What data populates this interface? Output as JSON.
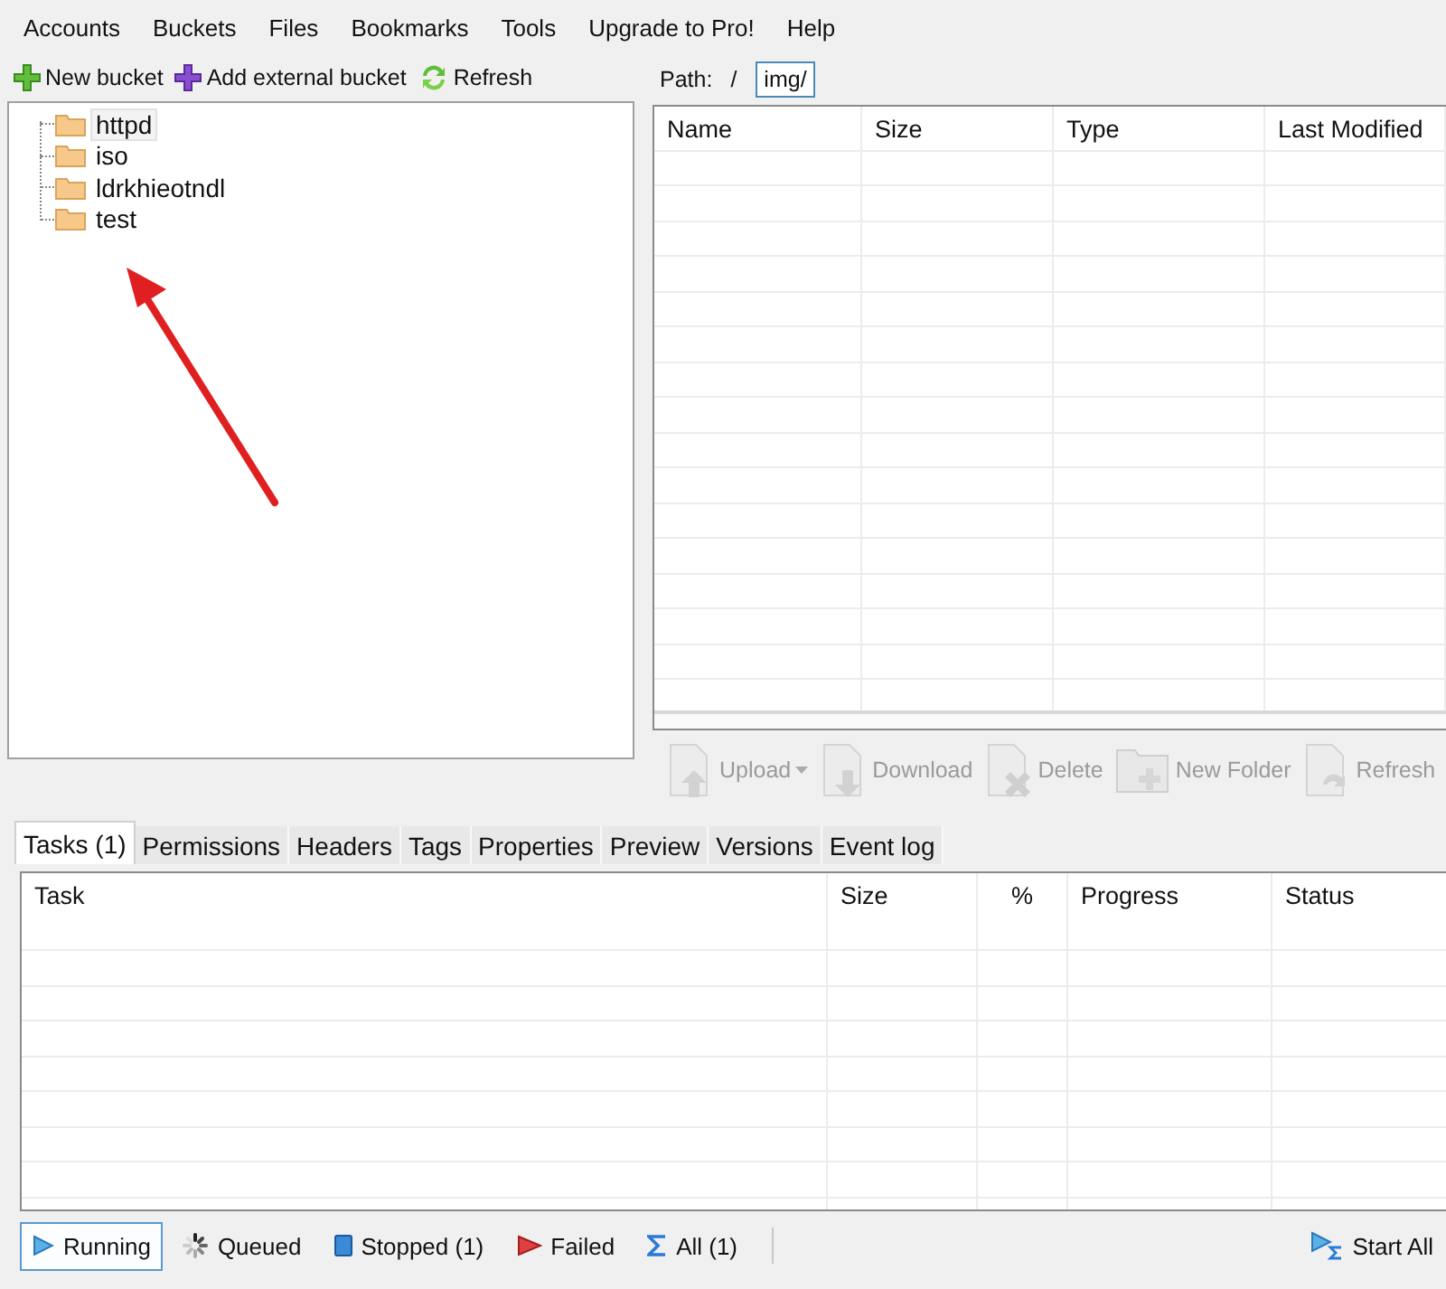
{
  "menu": [
    "Accounts",
    "Buckets",
    "Files",
    "Bookmarks",
    "Tools",
    "Upgrade to Pro!",
    "Help"
  ],
  "bucket_toolbar": [
    {
      "label": "New bucket",
      "kind": "plus"
    },
    {
      "label": "Add external bucket",
      "kind": "external"
    },
    {
      "label": "Refresh",
      "kind": "refresh"
    }
  ],
  "buckets": [
    {
      "name": "httpd",
      "selected": true
    },
    {
      "name": "iso",
      "selected": false
    },
    {
      "name": "ldrkhieotndl",
      "selected": false
    },
    {
      "name": "test",
      "selected": false
    }
  ],
  "path": {
    "label": "Path:",
    "separator": "/",
    "value": "img/"
  },
  "files_table": {
    "columns": [
      "Name",
      "Size",
      "Type",
      "Last Modified"
    ]
  },
  "file_toolbar": [
    {
      "label": "Upload",
      "kind": "upload",
      "disabled": true,
      "dropdown": true
    },
    {
      "label": "Download",
      "kind": "download",
      "disabled": true,
      "dropdown": false
    },
    {
      "label": "Delete",
      "kind": "delete",
      "disabled": true,
      "dropdown": false
    },
    {
      "label": "New Folder",
      "kind": "folder",
      "disabled": true,
      "dropdown": false
    },
    {
      "label": "Refresh",
      "kind": "refresh",
      "disabled": true,
      "dropdown": false
    }
  ],
  "tabs": [
    {
      "label": "Tasks (1)",
      "selected": true
    },
    {
      "label": "Permissions",
      "selected": false
    },
    {
      "label": "Headers",
      "selected": false
    },
    {
      "label": "Tags",
      "selected": false
    },
    {
      "label": "Properties",
      "selected": false
    },
    {
      "label": "Preview",
      "selected": false
    },
    {
      "label": "Versions",
      "selected": false
    },
    {
      "label": "Event log",
      "selected": false
    }
  ],
  "tasks_table": {
    "columns": [
      "Task",
      "Size",
      "%",
      "Progress",
      "Status"
    ]
  },
  "filters": [
    {
      "label": "Running",
      "kind": "running",
      "selected": true
    },
    {
      "label": "Queued",
      "kind": "queued",
      "selected": false
    },
    {
      "label": "Stopped (1)",
      "kind": "stopped",
      "selected": false
    },
    {
      "label": "Failed",
      "kind": "failed",
      "selected": false
    },
    {
      "label": "All (1)",
      "kind": "all",
      "selected": false
    }
  ],
  "start_all": {
    "label": "Start All"
  }
}
